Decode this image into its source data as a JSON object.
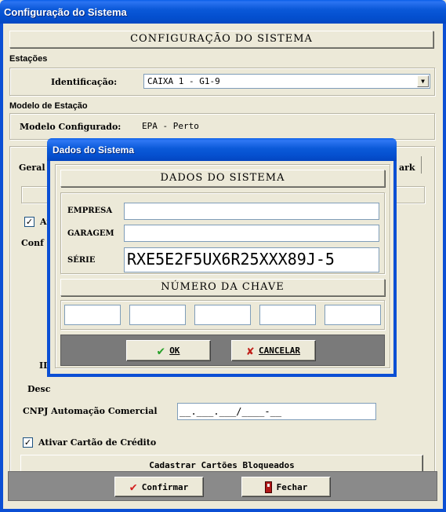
{
  "window": {
    "title": "Configuração do Sistema"
  },
  "header": {
    "title": "CONFIGURAÇÃO DO SISTEMA"
  },
  "estacoes": {
    "group_label": "Estações",
    "identificacao_label": "Identificação:",
    "identificacao_value": "CAIXA 1 - G1-9"
  },
  "modelo": {
    "group_label": "Modelo de Estação",
    "configurado_label": "Modelo Configurado:",
    "configurado_value": "EPA - Perto"
  },
  "tabs": {
    "left_fragment": "Geral",
    "right_fragment": "ark"
  },
  "background_form": {
    "ativar_fragment": "At",
    "conf_fragment": "Conf",
    "id_fragment": "ID",
    "desc_fragment": "Desc",
    "cnpj_label": "CNPJ Automação Comercial",
    "cnpj_value": "__.___.___/____-__",
    "ativar_cartao_label": "Ativar Cartão de Crédito",
    "cadastrar_label": "Cadastrar Cartões Bloqueados"
  },
  "footer": {
    "confirm_label": "Confirmar",
    "close_label": "Fechar"
  },
  "modal": {
    "title": "Dados do Sistema",
    "header": "DADOS DO SISTEMA",
    "empresa_label": "EMPRESA",
    "empresa_value": "",
    "garagem_label": "GARAGEM",
    "garagem_value": "",
    "serie_label": "SÉRIE",
    "serie_value": "RXE5E2F5UX6R25XXX89J-5",
    "chave_header": "NÚMERO DA CHAVE",
    "key_fields": [
      "",
      "",
      "",
      "",
      ""
    ],
    "ok_label": "OK",
    "cancel_label": "CANCELAR"
  },
  "colors": {
    "titlebar": "#0a58d8",
    "face": "#ece9d8",
    "modal_button_band": "#7a7a7a",
    "ok_check": "#2aa12a",
    "cancel_x": "#c0201a",
    "confirm_check": "#d42020"
  }
}
